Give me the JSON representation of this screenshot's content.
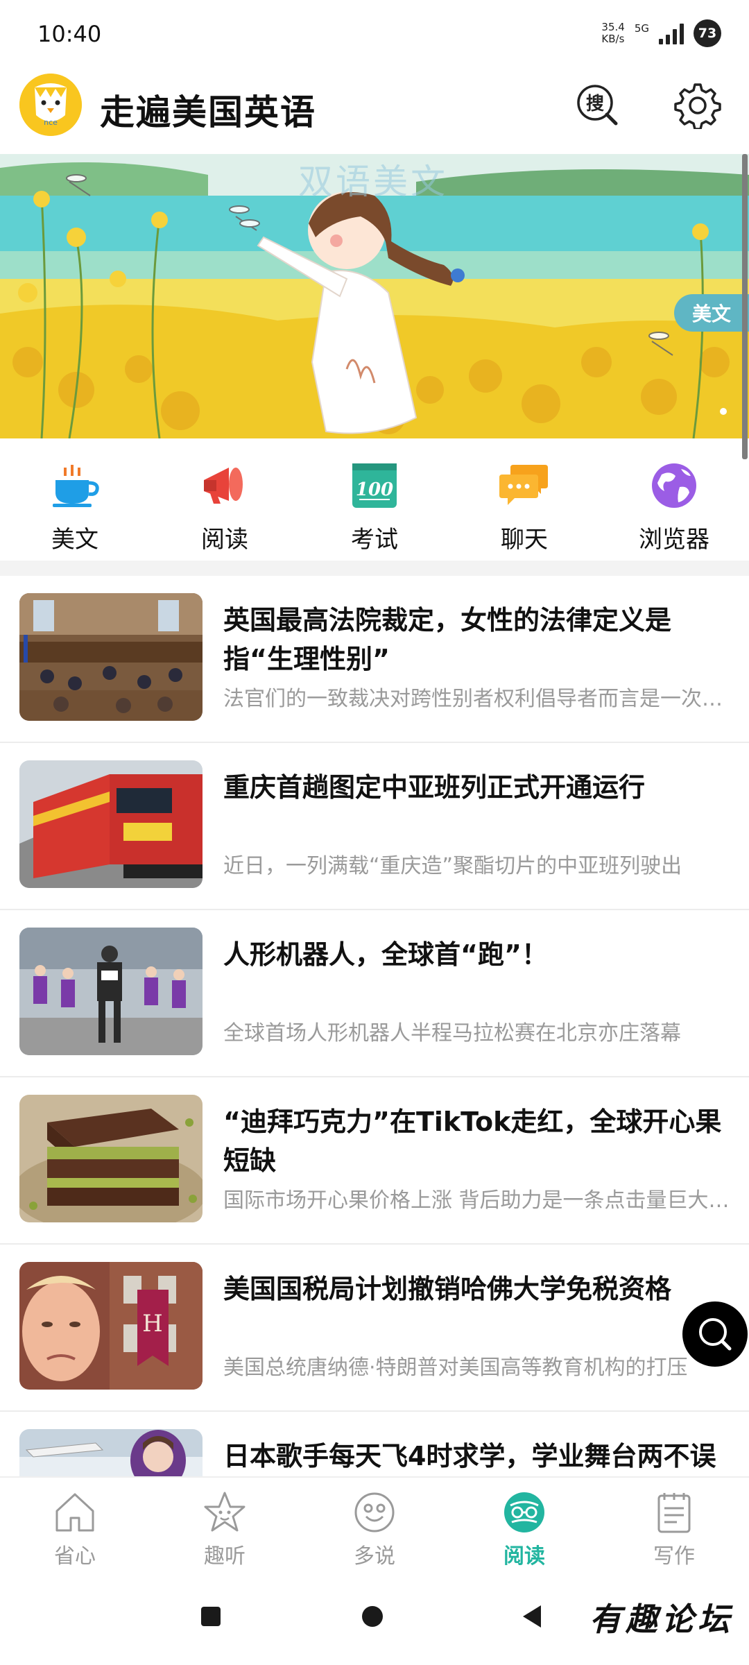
{
  "status_bar": {
    "time": "10:40",
    "net_speed_value": "35.4",
    "net_speed_unit": "KB/s",
    "network": "5G",
    "battery": "73"
  },
  "header": {
    "logo_text": "nce",
    "title": "走遍美国英语",
    "search_label": "搜",
    "search_icon": "search-icon",
    "settings_icon": "gear-icon"
  },
  "banner": {
    "watermark": "双语美文",
    "tag": "美文"
  },
  "categories": [
    {
      "label": "美文",
      "icon": "coffee-cup-icon"
    },
    {
      "label": "阅读",
      "icon": "megaphone-icon"
    },
    {
      "label": "考试",
      "icon": "score-100-icon"
    },
    {
      "label": "聊天",
      "icon": "chat-bubbles-icon"
    },
    {
      "label": "浏览器",
      "icon": "globe-icon"
    }
  ],
  "articles": [
    {
      "title": "英国最高法院裁定，女性的法律定义是指“生理性别”",
      "subtitle": "法官们的一致裁决对跨性别者权利倡导者而言是一次打击"
    },
    {
      "title": "重庆首趟图定中亚班列正式开通运行",
      "subtitle": "近日，一列满载“重庆造”聚酯切片的中亚班列驶出"
    },
    {
      "title": "人形机器人，全球首“跑”！",
      "subtitle": "全球首场人形机器人半程马拉松赛在北京亦庄落幕"
    },
    {
      "title": "“迪拜巧克力”在TikTok走红，全球开心果短缺",
      "subtitle": "国际市场开心果价格上涨 背后助力是一条点击量巨大的视频"
    },
    {
      "title": "美国国税局计划撤销哈佛大学免税资格",
      "subtitle": "美国总统唐纳德·特朗普对美国高等教育机构的打压"
    },
    {
      "title": "日本歌手每天飞4时求学，学业舞台两不误",
      "subtitle": ""
    }
  ],
  "bottom_nav": [
    {
      "label": "省心",
      "icon": "home-icon",
      "active": false
    },
    {
      "label": "趣听",
      "icon": "star-icon",
      "active": false
    },
    {
      "label": "多说",
      "icon": "smiley-icon",
      "active": false
    },
    {
      "label": "阅读",
      "icon": "glasses-book-icon",
      "active": true
    },
    {
      "label": "写作",
      "icon": "notepad-icon",
      "active": false
    }
  ],
  "watermark_footer": "有趣论坛",
  "colors": {
    "accent": "#22b5a0",
    "logo_yellow": "#f9c61f",
    "banner_tag": "#5fb6c4",
    "muted_text": "#9a9a9a"
  }
}
